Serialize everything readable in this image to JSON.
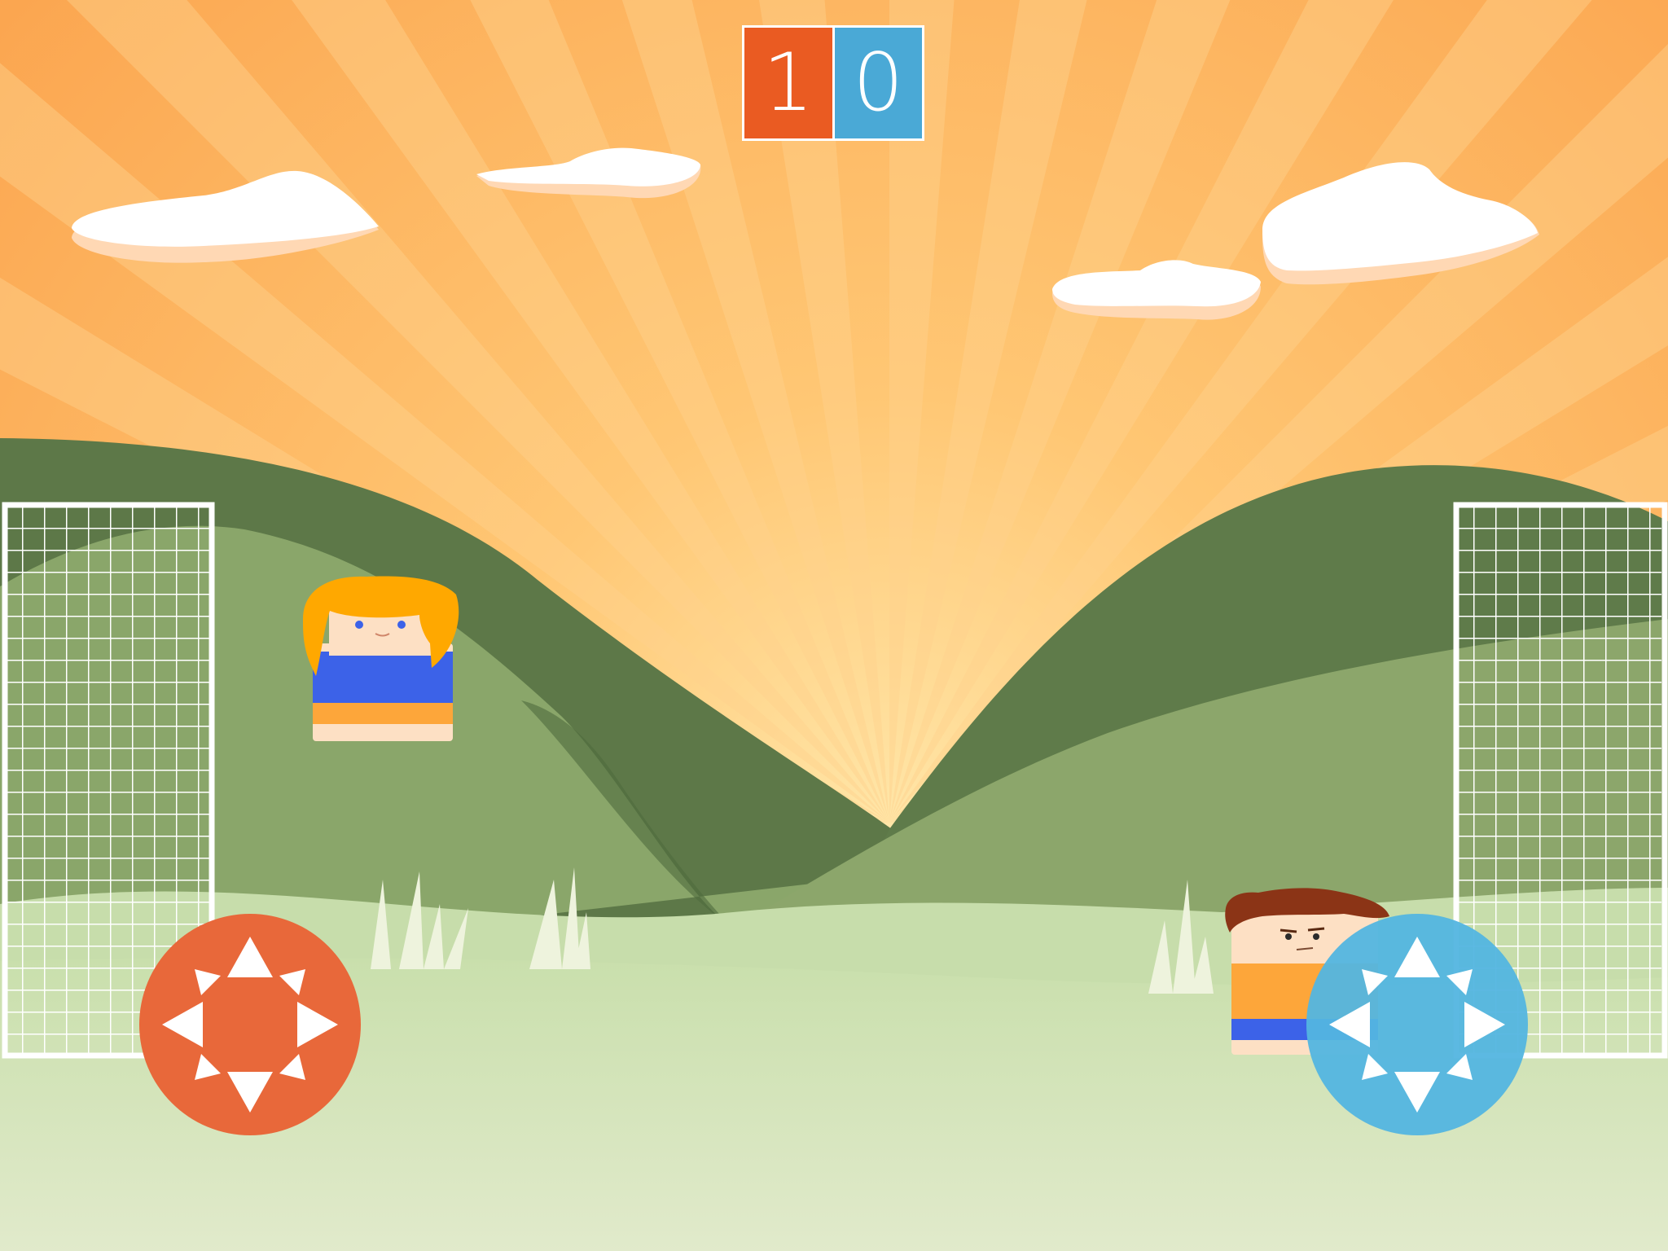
{
  "score": {
    "left": "1",
    "right": "0"
  },
  "colors": {
    "team_left": "#ea5b22",
    "team_right": "#4aa9d6",
    "dpad_left": "#e8683a",
    "dpad_right": "#53b5e0",
    "sky_base": "#fdb457",
    "sky_rays": "#ffd694",
    "hill_dark": "#5e7a48",
    "hill_mid": "#8ca86b",
    "grass_light": "#e0eac9",
    "jersey_blue": "#3c62e8",
    "jersey_orange": "#fda63a"
  },
  "players": [
    {
      "team": "left",
      "hair": "orange",
      "jersey": "blue-orange"
    },
    {
      "team": "right",
      "hair": "brown",
      "jersey": "orange-blue"
    }
  ],
  "controls": [
    {
      "side": "left",
      "icon": "dpad-icon"
    },
    {
      "side": "right",
      "icon": "dpad-icon"
    }
  ]
}
